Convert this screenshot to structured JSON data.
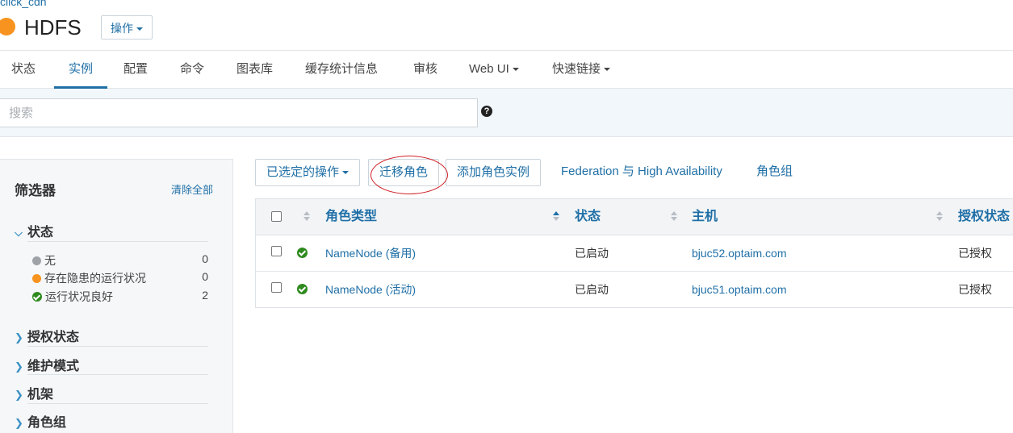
{
  "header": {
    "cluster_link": "click_cdh",
    "service_name": "HDFS",
    "actions_label": "操作",
    "status_color": "#f7931e"
  },
  "tabs": [
    {
      "label": "状态",
      "active": false
    },
    {
      "label": "实例",
      "active": true
    },
    {
      "label": "配置",
      "active": false
    },
    {
      "label": "命令",
      "active": false
    },
    {
      "label": "图表库",
      "active": false
    },
    {
      "label": "缓存统计信息",
      "active": false
    },
    {
      "label": "审核",
      "active": false
    },
    {
      "label": "Web UI",
      "active": false,
      "dropdown": true
    },
    {
      "label": "快速链接",
      "active": false,
      "dropdown": true
    }
  ],
  "search": {
    "placeholder": "搜索",
    "value": "",
    "help_icon": "question-circle-icon"
  },
  "sidebar": {
    "title": "筛选器",
    "clear_all": "清除全部",
    "sections": [
      {
        "label": "状态",
        "expanded": true,
        "items": [
          {
            "label": "无",
            "count": "0",
            "icon": "gray-dot"
          },
          {
            "label": "存在隐患的运行状况",
            "count": "0",
            "icon": "orange-dot"
          },
          {
            "label": "运行状况良好",
            "count": "2",
            "icon": "green-check"
          }
        ]
      },
      {
        "label": "授权状态",
        "expanded": false
      },
      {
        "label": "维护模式",
        "expanded": false
      },
      {
        "label": "机架",
        "expanded": false
      },
      {
        "label": "角色组",
        "expanded": false
      }
    ]
  },
  "actions": {
    "selected_actions": "已选定的操作",
    "migrate_roles": "迁移角色",
    "add_role_instances": "添加角色实例",
    "federation_ha": "Federation 与 High Availability",
    "role_groups": "角色组",
    "highlight_color": "#d01f25"
  },
  "table": {
    "columns": [
      "角色类型",
      "状态",
      "主机",
      "授权状态"
    ],
    "rows": [
      {
        "role_type": "NameNode (备用)",
        "status": "已启动",
        "host": "bjuc52.optaim.com",
        "auth": "已授权",
        "health": "good"
      },
      {
        "role_type": "NameNode (活动)",
        "status": "已启动",
        "host": "bjuc51.optaim.com",
        "auth": "已授权",
        "health": "good"
      }
    ]
  }
}
